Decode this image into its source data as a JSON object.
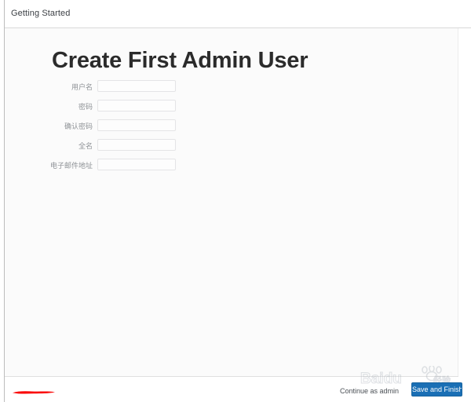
{
  "window": {
    "breadcrumb": "Getting Started"
  },
  "page": {
    "title": "Create First Admin User"
  },
  "form": {
    "fields": [
      {
        "label": "用户名",
        "value": "",
        "placeholder": "",
        "name": "username"
      },
      {
        "label": "密码",
        "value": "",
        "placeholder": "",
        "name": "password"
      },
      {
        "label": "确认密码",
        "value": "",
        "placeholder": "",
        "name": "confirm-password"
      },
      {
        "label": "全名",
        "value": "",
        "placeholder": "",
        "name": "full-name"
      },
      {
        "label": "电子邮件地址",
        "value": "",
        "placeholder": "",
        "name": "email-address"
      }
    ]
  },
  "footer": {
    "continue_as_admin_label": "Continue as admin",
    "save_and_finish_label": "Save and Finish"
  },
  "watermark": {
    "text": "Baidu",
    "subtext": "经验"
  },
  "colors": {
    "primary_button": "#1a6fb5",
    "annotation_red": "#fa0a0a",
    "panel_background": "#fbfbfb",
    "label_text": "#8e9296",
    "title_text": "#2b2b2b"
  }
}
